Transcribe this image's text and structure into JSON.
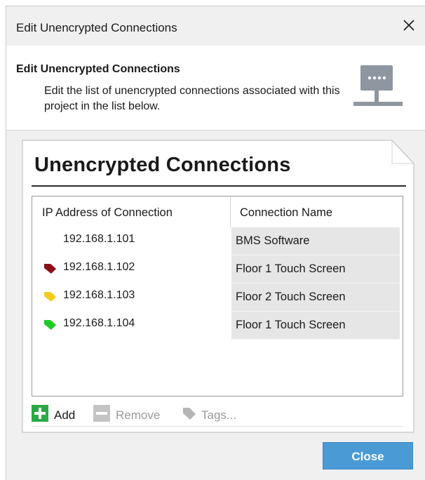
{
  "window": {
    "title": "Edit Unencrypted Connections",
    "close_glyph": "✕"
  },
  "header": {
    "title": "Edit Unencrypted Connections",
    "description": "Edit the list of unencrypted connections associated with this project in the list below.",
    "icon": "network-icon"
  },
  "panel": {
    "title": "Unencrypted Connections",
    "columns": [
      "IP Address of Connection",
      "Connection Name"
    ],
    "rows": [
      {
        "ip": "192.168.1.101",
        "name": "BMS Software",
        "tag_color": ""
      },
      {
        "ip": "192.168.1.102",
        "name": "Floor 1 Touch Screen",
        "tag_color": "#8b0e1a"
      },
      {
        "ip": "192.168.1.103",
        "name": "Floor 2 Touch Screen",
        "tag_color": "#f5cc1c"
      },
      {
        "ip": "192.168.1.104",
        "name": "Floor 1 Touch Screen",
        "tag_color": "#1ecb24"
      }
    ]
  },
  "toolbar": {
    "add_label": "Add",
    "remove_label": "Remove",
    "tags_label": "Tags...",
    "add_color": "#2aa845"
  },
  "footer": {
    "close_label": "Close",
    "close_color": "#4a9ad6"
  }
}
